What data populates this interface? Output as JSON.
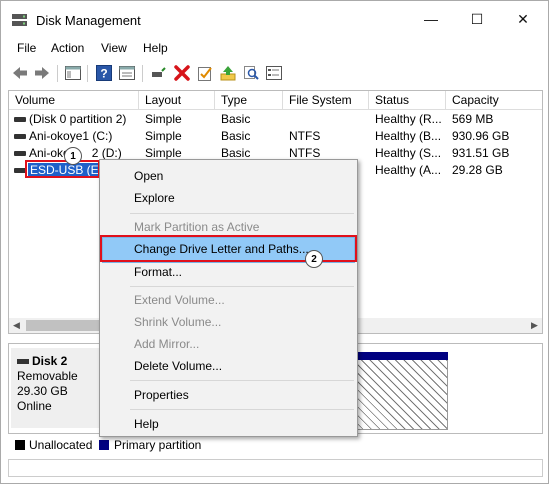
{
  "window": {
    "title": "Disk Management",
    "controls": {
      "minimize": "—",
      "maximize": "☐",
      "close": "✕"
    }
  },
  "menubar": [
    "File",
    "Action",
    "View",
    "Help"
  ],
  "toolbar": {
    "icons": [
      "back-arrow-icon",
      "forward-arrow-icon",
      "console-tree-icon",
      "help-icon",
      "properties-icon",
      "connect-icon",
      "delete-icon",
      "checklist-icon",
      "import-icon",
      "search-icon",
      "list-icon"
    ]
  },
  "volume_list": {
    "columns": [
      "Volume",
      "Layout",
      "Type",
      "File System",
      "Status",
      "Capacity"
    ],
    "rows": [
      {
        "volume": "(Disk 0 partition 2)",
        "layout": "Simple",
        "type": "Basic",
        "fs": "",
        "status": "Healthy (R...",
        "capacity": "569 MB"
      },
      {
        "volume": "Ani-okoye1 (C:)",
        "layout": "Simple",
        "type": "Basic",
        "fs": "NTFS",
        "status": "Healthy (B...",
        "capacity": "930.96 GB"
      },
      {
        "volume": "Ani-okoye2 (D:)",
        "layout": "Simple",
        "type": "Basic",
        "fs": "NTFS",
        "status": "Healthy (S...",
        "capacity": "931.51 GB"
      },
      {
        "volume": "ESD-USB (E:)",
        "layout": "",
        "type": "",
        "fs": "",
        "status": "Healthy (A...",
        "capacity": "29.28 GB"
      }
    ],
    "volume_row2_visible": "Ani-oko",
    "volume_row2_tail": "2 (D:)",
    "selected_row": 3
  },
  "callouts": {
    "one": "1",
    "two": "2"
  },
  "disk": {
    "name": "Disk 2",
    "type": "Removable",
    "size": "29.30 GB",
    "state": "Online"
  },
  "legend": {
    "unallocated": "Unallocated",
    "primary": "Primary partition",
    "colors": {
      "unallocated": "#000000",
      "primary": "#000080"
    }
  },
  "context_menu": {
    "items": [
      {
        "label": "Open",
        "enabled": true
      },
      {
        "label": "Explore",
        "enabled": true
      },
      {
        "label": "Mark Partition as Active",
        "enabled": false
      },
      {
        "label": "Change Drive Letter and Paths...",
        "enabled": true,
        "highlighted": true
      },
      {
        "label": "Format...",
        "enabled": true
      },
      {
        "label": "Extend Volume...",
        "enabled": false
      },
      {
        "label": "Shrink Volume...",
        "enabled": false
      },
      {
        "label": "Add Mirror...",
        "enabled": false
      },
      {
        "label": "Delete Volume...",
        "enabled": true
      },
      {
        "label": "Properties",
        "enabled": true
      },
      {
        "label": "Help",
        "enabled": true
      }
    ]
  },
  "colors": {
    "selection": "#1e60c9",
    "menu_highlight": "#91c9f7",
    "callout_border": "#e0101b"
  }
}
